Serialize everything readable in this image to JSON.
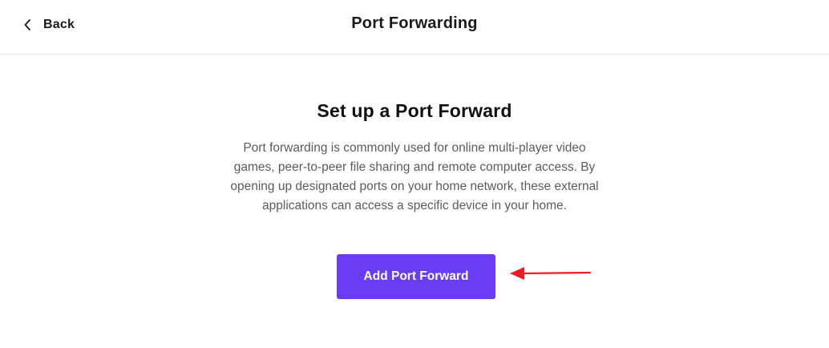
{
  "header": {
    "back_label": "Back",
    "title": "Port Forwarding",
    "back_icon": "chevron-left-icon"
  },
  "main": {
    "heading": "Set up a Port Forward",
    "description": "Port forwarding is commonly used for online multi-player video games, peer-to-peer file sharing and remote computer access. By opening up designated ports on your home network, these external applications can access a specific device in your home.",
    "button_label": "Add Port Forward"
  },
  "colors": {
    "accent": "#6b3cf5",
    "annotation": "#ee1c25"
  }
}
